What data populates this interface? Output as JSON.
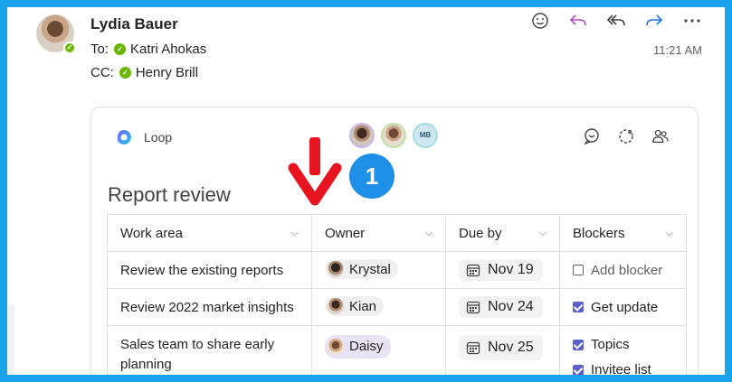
{
  "email": {
    "sender": "Lydia Bauer",
    "to_label": "To:",
    "to_name": "Katri Ahokas",
    "cc_label": "CC:",
    "cc_name": "Henry Brill",
    "time": "11:21 AM"
  },
  "actions": [
    {
      "name": "emoji-icon",
      "glyph": "☺"
    },
    {
      "name": "reply-icon",
      "glyph": "↶"
    },
    {
      "name": "reply-all-icon",
      "glyph": "⟲"
    },
    {
      "name": "forward-icon",
      "glyph": "↷"
    },
    {
      "name": "more-icon",
      "glyph": "···"
    }
  ],
  "loop": {
    "app_name": "Loop",
    "collaborator_initials": "MB",
    "title": "Report review"
  },
  "table": {
    "columns": [
      "Work area",
      "Owner",
      "Due by",
      "Blockers"
    ],
    "rows": [
      {
        "work": "Review the existing reports",
        "owner": "Krystal",
        "due": "Nov 19",
        "blockers": [
          "Add blocker"
        ]
      },
      {
        "work": "Review 2022 market insights",
        "owner": "Kian",
        "due": "Nov 24",
        "blockers": [
          "Get update"
        ]
      },
      {
        "work": "Sales team to share early planning",
        "owner": "Daisy",
        "due": "Nov 25",
        "blockers": [
          "Topics",
          "Invitee list"
        ]
      }
    ]
  },
  "annotation": {
    "step_number": "1"
  },
  "colors": {
    "frame": "#1aa3e8",
    "accent": "#5b5fc7",
    "arrow": "#e8141f",
    "badge": "#1e90e8",
    "presence": "#6bb700"
  }
}
